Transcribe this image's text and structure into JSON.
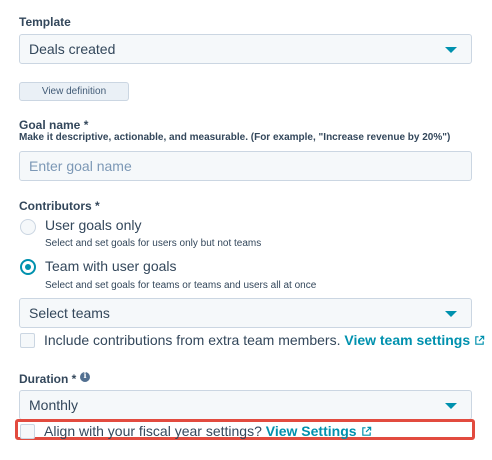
{
  "template": {
    "label": "Template",
    "selected": "Deals created",
    "view_definition_label": "View definition"
  },
  "goal_name": {
    "label": "Goal name *",
    "help": "Make it descriptive, actionable, and measurable. (For example, \"Increase revenue by 20%\")",
    "placeholder": "Enter goal name",
    "value": ""
  },
  "contributors": {
    "label": "Contributors *",
    "options": [
      {
        "label": "User goals only",
        "help": "Select and set goals for users only but not teams",
        "checked": false
      },
      {
        "label": "Team with user goals",
        "help": "Select and set goals for teams or teams and users all at once",
        "checked": true
      }
    ],
    "teams_select": "Select teams",
    "include_extra_label": "Include contributions from extra team members.",
    "view_team_settings": "View team settings"
  },
  "duration": {
    "label": "Duration *",
    "selected": "Monthly",
    "fiscal_label": "Align with your fiscal year settings?",
    "view_settings": "View Settings"
  },
  "icons": {
    "dropdown": "caret-down-icon",
    "external": "external-link-icon",
    "info": "info-icon"
  },
  "colors": {
    "accent": "#0091ae",
    "text": "#33475b",
    "field_bg": "#f5f8fa",
    "border": "#cbd6e2",
    "highlight": "#e24b3f"
  }
}
